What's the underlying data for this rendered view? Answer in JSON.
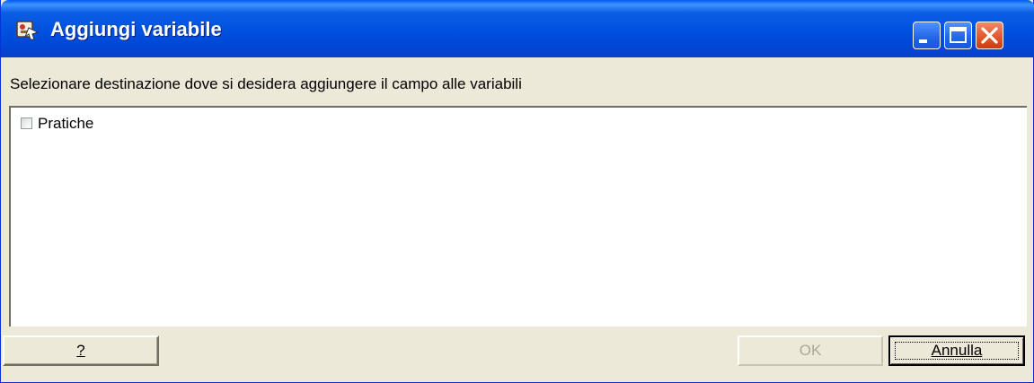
{
  "window": {
    "title": "Aggiungi variabile",
    "icon": "app-variables-icon",
    "title_buttons": [
      "minimize-icon",
      "maximize-icon",
      "close-icon"
    ],
    "title_color": "#0a5fe4",
    "close_color": "#e25a2c"
  },
  "prompt": "Selezionare destinazione dove si desidera aggiungere il campo alle variabili",
  "list": {
    "items": [
      {
        "label": "Pratiche",
        "checked": false
      }
    ]
  },
  "buttons": {
    "help_label": "?",
    "ok_label": "OK",
    "ok_enabled": false,
    "cancel_label": "Annulla"
  }
}
